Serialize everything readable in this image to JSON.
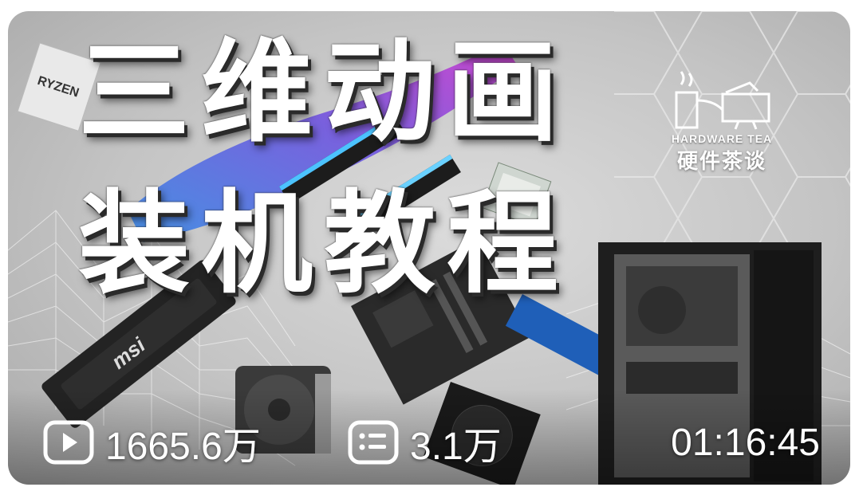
{
  "video_card": {
    "title_line1": "三维动画",
    "title_line2": "装机教程",
    "channel_brand": {
      "name_en": "HARDWARE TEA",
      "name_cn": "硬件茶谈"
    },
    "views": "1665.6万",
    "danmaku": "3.1万",
    "duration": "01:16:45",
    "component_labels": {
      "cpu_box": "RYZEN",
      "gpu_brand": "msi"
    },
    "colors": {
      "accent_paint_blue": "#2f86e8",
      "accent_paint_pink": "#d12fd0",
      "title_text": "#ffffff"
    },
    "icons": [
      "play-views-icon",
      "danmaku-icon"
    ]
  }
}
